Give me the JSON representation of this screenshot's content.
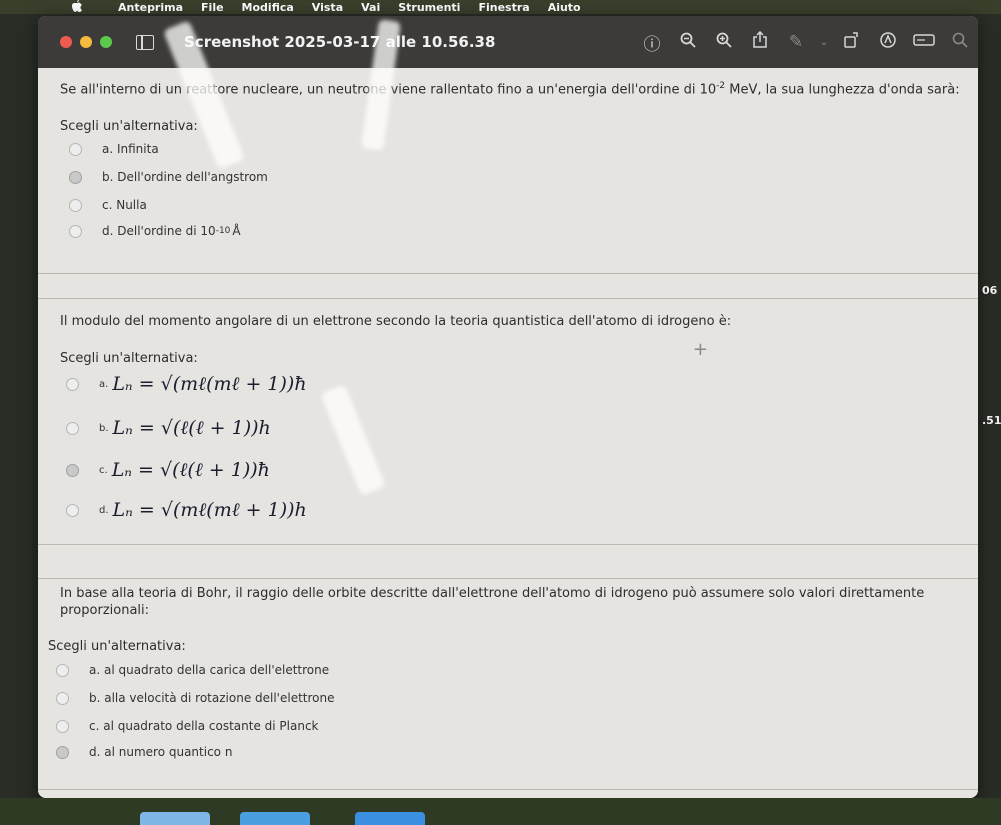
{
  "menubar": {
    "items": [
      "Anteprima",
      "File",
      "Modifica",
      "Vista",
      "Vai",
      "Strumenti",
      "Finestra",
      "Aiuto"
    ]
  },
  "window": {
    "title": "Screenshot 2025-03-17 alle 10.56.38",
    "tool_icons": [
      "info-icon",
      "zoom-out-icon",
      "zoom-in-icon",
      "share-icon",
      "markup-icon",
      "rotate-icon",
      "highlight-icon",
      "redact-icon",
      "search-icon"
    ]
  },
  "q1": {
    "text_before": "Se all'interno di un reattore nucleare, un neutrone viene rallentato fino a un'energia dell'ordine di 10",
    "exponent": "-2",
    "text_after": " MeV, la sua lunghezza d'onda sarà:",
    "prompt": "Scegli un'alternativa:",
    "options": [
      {
        "label": "a. Infinita"
      },
      {
        "label": "b. Dell'ordine dell'angstrom"
      },
      {
        "label": "c. Nulla"
      },
      {
        "label": "d. Dell'ordine di 10",
        "exp": "-10",
        "unit": "Å"
      }
    ]
  },
  "q2": {
    "text": "Il modulo del momento angolare di un elettrone secondo la teoria quantistica dell'atomo di idrogeno è:",
    "prompt": "Scegli un'alternativa:",
    "options": [
      {
        "letter": "a.",
        "formula": "Lₙ = √(mℓ(mℓ + 1))ħ"
      },
      {
        "letter": "b.",
        "formula": "Lₙ = √(ℓ(ℓ + 1))h"
      },
      {
        "letter": "c.",
        "formula": "Lₙ = √(ℓ(ℓ + 1))ħ"
      },
      {
        "letter": "d.",
        "formula": "Lₙ = √(mℓ(mℓ + 1))h"
      }
    ],
    "plus": "+"
  },
  "q3": {
    "text": "In base alla teoria di Bohr, il raggio delle orbite descritte dall'elettrone dell'atomo di idrogeno può assumere solo valori direttamente proporzionali:",
    "prompt": "Scegli un'alternativa:",
    "options": [
      {
        "label": "a. al quadrato della carica dell'elettrone"
      },
      {
        "label": "b. alla velocità di rotazione dell'elettrone"
      },
      {
        "label": "c. al quadrato della costante di Planck"
      },
      {
        "label": "d. al numero quantico n"
      }
    ]
  },
  "side_labels": [
    "06",
    ".51"
  ]
}
